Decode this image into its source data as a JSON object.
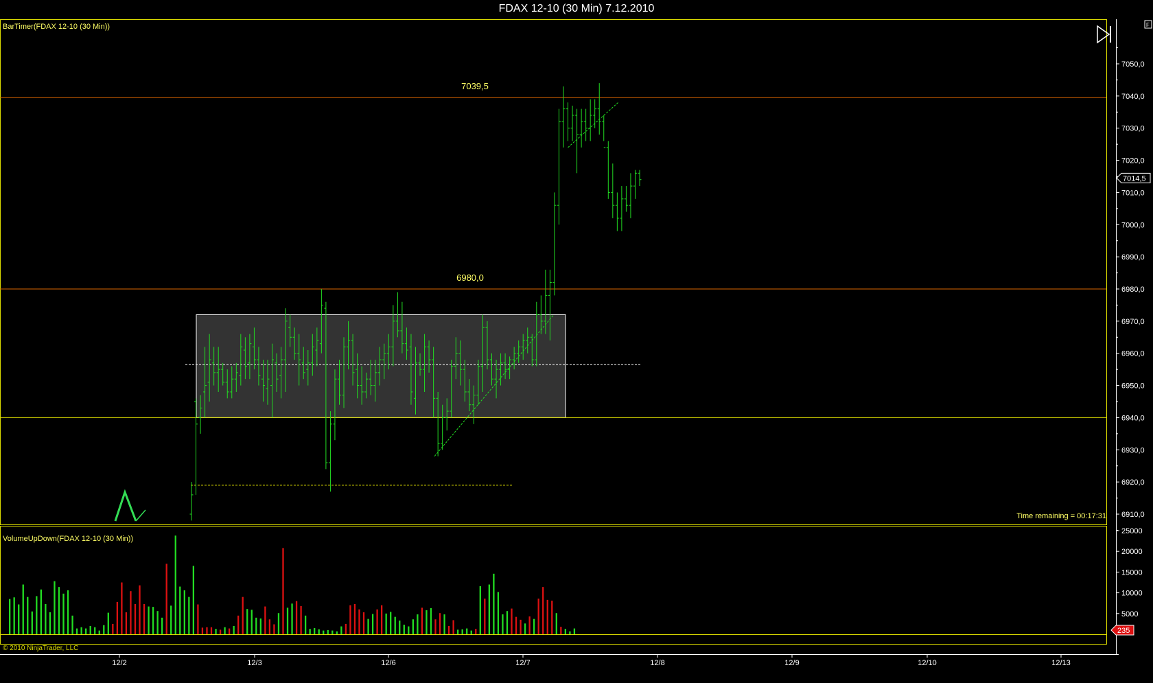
{
  "window": {
    "title": "FDAX 12-10 (30 Min)  7.12.2010"
  },
  "indicators": {
    "price_label": "BarTimer(FDAX 12-10 (30 Min))",
    "volume_label": "VolumeUpDown(FDAX 12-10 (30 Min))",
    "time_remaining": "Time remaining = 00:17:31",
    "copyright": "© 2010 NinjaTrader, LLC"
  },
  "colors": {
    "up": "#22dd22",
    "down": "#dd1111",
    "level_orange": "#dd6600",
    "level_yellow": "#dddd00",
    "panel_border": "#dddd00",
    "range_box": "#444444",
    "axis_text": "#ffffff"
  },
  "icons": {
    "play_end": "play-end-icon"
  },
  "chart_data": [
    {
      "type": "bar",
      "subtype": "ohlc",
      "title": "FDAX 12-10 (30 Min)  7.12.2010",
      "ylim": [
        6905,
        7062
      ],
      "y_ticks": [
        6910,
        6920,
        6930,
        6940,
        6950,
        6960,
        6970,
        6980,
        6990,
        7000,
        7010,
        7020,
        7030,
        7040,
        7050
      ],
      "y_tick_labels": [
        "6910,0",
        "6920,0",
        "6930,0",
        "6940,0",
        "6950,0",
        "6960,0",
        "6970,0",
        "6980,0",
        "6990,0",
        "7000,0",
        "7010,0",
        "7020,0",
        "7030,0",
        "7040,0",
        "7050,0"
      ],
      "x_tick_labels": [
        "12/2",
        "12/3",
        "12/6",
        "12/7",
        "12/8",
        "12/9",
        "12/10",
        "12/13"
      ],
      "levels": [
        {
          "value": 7039.5,
          "label": "7039,5",
          "color": "#dd6600"
        },
        {
          "value": 6980.0,
          "label": "6980,0",
          "color": "#dd6600"
        },
        {
          "value": 6940.0,
          "label": "",
          "color": "#dddd00"
        }
      ],
      "last_price": "7014,5",
      "range_box": {
        "top": 6972,
        "bottom": 6940
      },
      "midline": 6956.5,
      "support_dotted": 6919,
      "bars": [
        [
          6910,
          6908,
          6920,
          6916
        ],
        [
          6945,
          6916,
          6946,
          6938
        ],
        [
          6940,
          6935,
          6947,
          6943
        ],
        [
          6948,
          6940,
          6962,
          6950
        ],
        [
          6951,
          6945,
          6966,
          6958
        ],
        [
          6957,
          6950,
          6962,
          6954
        ],
        [
          6954,
          6948,
          6962,
          6955
        ],
        [
          6955,
          6950,
          6957,
          6951
        ],
        [
          6951,
          6946,
          6955,
          6948
        ],
        [
          6948,
          6946,
          6956,
          6952
        ],
        [
          6952,
          6948,
          6957,
          6954
        ],
        [
          6953,
          6950,
          6966,
          6962
        ],
        [
          6961,
          6952,
          6965,
          6956
        ],
        [
          6957,
          6952,
          6966,
          6963
        ],
        [
          6962,
          6955,
          6968,
          6958
        ],
        [
          6958,
          6950,
          6962,
          6953
        ],
        [
          6952,
          6945,
          6958,
          6950
        ],
        [
          6949,
          6944,
          6958,
          6952
        ],
        [
          6950,
          6940,
          6963,
          6958
        ],
        [
          6957,
          6948,
          6960,
          6952
        ],
        [
          6953,
          6946,
          6962,
          6958
        ],
        [
          6958,
          6948,
          6974,
          6970
        ],
        [
          6968,
          6962,
          6972,
          6965
        ],
        [
          6965,
          6958,
          6968,
          6960
        ],
        [
          6960,
          6950,
          6966,
          6958
        ],
        [
          6957,
          6952,
          6962,
          6954
        ],
        [
          6955,
          6950,
          6961,
          6957
        ],
        [
          6957,
          6953,
          6966,
          6962
        ],
        [
          6961,
          6956,
          6968,
          6964
        ],
        [
          6963,
          6960,
          6980,
          6975
        ],
        [
          6974,
          6924,
          6976,
          6926
        ],
        [
          6926,
          6917,
          6942,
          6938
        ],
        [
          6938,
          6933,
          6955,
          6952
        ],
        [
          6952,
          6944,
          6958,
          6947
        ],
        [
          6947,
          6943,
          6965,
          6962
        ],
        [
          6962,
          6955,
          6970,
          6964
        ],
        [
          6964,
          6950,
          6966,
          6954
        ],
        [
          6955,
          6946,
          6960,
          6950
        ],
        [
          6950,
          6944,
          6956,
          6948
        ],
        [
          6948,
          6946,
          6954,
          6952
        ],
        [
          6952,
          6947,
          6958,
          6950
        ],
        [
          6950,
          6945,
          6958,
          6954
        ],
        [
          6954,
          6950,
          6962,
          6958
        ],
        [
          6958,
          6952,
          6963,
          6960
        ],
        [
          6960,
          6955,
          6966,
          6962
        ],
        [
          6962,
          6956,
          6975,
          6970
        ],
        [
          6970,
          6965,
          6979,
          6967
        ],
        [
          6967,
          6960,
          6976,
          6963
        ],
        [
          6963,
          6958,
          6968,
          6961
        ],
        [
          6962,
          6944,
          6966,
          6948
        ],
        [
          6946,
          6941,
          6962,
          6957
        ],
        [
          6957,
          6953,
          6960,
          6955
        ],
        [
          6955,
          6948,
          6966,
          6962
        ],
        [
          6962,
          6954,
          6964,
          6958
        ],
        [
          6958,
          6940,
          6962,
          6946
        ],
        [
          6946,
          6928,
          6948,
          6932
        ],
        [
          6932,
          6930,
          6944,
          6940
        ],
        [
          6940,
          6936,
          6946,
          6942
        ],
        [
          6942,
          6940,
          6958,
          6956
        ],
        [
          6956,
          6952,
          6965,
          6960
        ],
        [
          6960,
          6950,
          6964,
          6955
        ],
        [
          6955,
          6945,
          6958,
          6948
        ],
        [
          6948,
          6942,
          6952,
          6944
        ],
        [
          6944,
          6938,
          6950,
          6947
        ],
        [
          6947,
          6944,
          6958,
          6956
        ],
        [
          6956,
          6948,
          6972,
          6968
        ],
        [
          6968,
          6955,
          6970,
          6958
        ],
        [
          6958,
          6950,
          6960,
          6952
        ],
        [
          6952,
          6946,
          6958,
          6955
        ],
        [
          6955,
          6950,
          6960,
          6957
        ],
        [
          6957,
          6952,
          6960,
          6955
        ],
        [
          6955,
          6952,
          6959,
          6958
        ],
        [
          6958,
          6955,
          6962,
          6960
        ],
        [
          6960,
          6957,
          6964,
          6962
        ],
        [
          6962,
          6958,
          6966,
          6964
        ],
        [
          6964,
          6960,
          6968,
          6965
        ],
        [
          6965,
          6956,
          6966,
          6958
        ],
        [
          6958,
          6956,
          6976,
          6972
        ],
        [
          6972,
          6966,
          6978,
          6970
        ],
        [
          6970,
          6966,
          6986,
          6978
        ],
        [
          6978,
          6964,
          6986,
          6982
        ],
        [
          6982,
          6978,
          7010,
          7006
        ],
        [
          7006,
          7000,
          7036,
          7032
        ],
        [
          7032,
          7024,
          7043,
          7036
        ],
        [
          7036,
          7026,
          7038,
          7030
        ],
        [
          7030,
          7026,
          7037,
          7034
        ],
        [
          7034,
          7016,
          7036,
          7028
        ],
        [
          7028,
          7024,
          7036,
          7032
        ],
        [
          7032,
          7026,
          7036,
          7030
        ],
        [
          7030,
          7026,
          7039,
          7034
        ],
        [
          7034,
          7030,
          7039,
          7036
        ],
        [
          7036,
          7028,
          7044,
          7032
        ],
        [
          7032,
          7026,
          7034,
          7024
        ],
        [
          7024,
          7008,
          7026,
          7010
        ],
        [
          7010,
          7002,
          7019,
          7006
        ],
        [
          7006,
          6998,
          7010,
          7002
        ],
        [
          7002,
          6998,
          7012,
          7008
        ],
        [
          7008,
          7004,
          7012,
          7006
        ],
        [
          7006,
          7002,
          7016,
          7012
        ],
        [
          7012,
          7008,
          7017,
          7016
        ],
        [
          7016,
          7012,
          7017,
          7014
        ]
      ]
    },
    {
      "type": "bar",
      "title": "VolumeUpDown(FDAX 12-10 (30 Min))",
      "ylim": [
        0,
        26000
      ],
      "y_ticks": [
        5000,
        10000,
        15000,
        20000,
        25000
      ],
      "y_tick_labels": [
        "5000",
        "10000",
        "15000",
        "20000",
        "25000"
      ],
      "last_value": "235",
      "bars": [
        [
          8500,
          "up"
        ],
        [
          8900,
          "up"
        ],
        [
          7200,
          "up"
        ],
        [
          12000,
          "up"
        ],
        [
          9000,
          "up"
        ],
        [
          5500,
          "up"
        ],
        [
          9200,
          "up"
        ],
        [
          10800,
          "up"
        ],
        [
          7300,
          "up"
        ],
        [
          5300,
          "up"
        ],
        [
          12800,
          "up"
        ],
        [
          11400,
          "up"
        ],
        [
          9800,
          "up"
        ],
        [
          10600,
          "up"
        ],
        [
          4500,
          "up"
        ],
        [
          1400,
          "up"
        ],
        [
          1700,
          "up"
        ],
        [
          1400,
          "up"
        ],
        [
          2000,
          "up"
        ],
        [
          1700,
          "up"
        ],
        [
          900,
          "up"
        ],
        [
          2200,
          "up"
        ],
        [
          5200,
          "up"
        ],
        [
          2500,
          "down"
        ],
        [
          7800,
          "down"
        ],
        [
          12500,
          "down"
        ],
        [
          5300,
          "down"
        ],
        [
          10400,
          "down"
        ],
        [
          7300,
          "down"
        ],
        [
          11800,
          "down"
        ],
        [
          7300,
          "down"
        ],
        [
          6700,
          "up"
        ],
        [
          6600,
          "up"
        ],
        [
          5600,
          "up"
        ],
        [
          4000,
          "up"
        ],
        [
          17000,
          "down"
        ],
        [
          6900,
          "up"
        ],
        [
          23800,
          "up"
        ],
        [
          11500,
          "up"
        ],
        [
          10600,
          "up"
        ],
        [
          9000,
          "up"
        ],
        [
          16500,
          "up"
        ],
        [
          7200,
          "down"
        ],
        [
          1600,
          "down"
        ],
        [
          1700,
          "down"
        ],
        [
          1700,
          "down"
        ],
        [
          1300,
          "up"
        ],
        [
          1100,
          "down"
        ],
        [
          1700,
          "up"
        ],
        [
          1400,
          "down"
        ],
        [
          2000,
          "up"
        ],
        [
          4500,
          "down"
        ],
        [
          9000,
          "down"
        ],
        [
          6100,
          "up"
        ],
        [
          5900,
          "up"
        ],
        [
          4000,
          "up"
        ],
        [
          3800,
          "up"
        ],
        [
          6700,
          "down"
        ],
        [
          3600,
          "down"
        ],
        [
          2400,
          "down"
        ],
        [
          5100,
          "up"
        ],
        [
          20800,
          "down"
        ],
        [
          6400,
          "up"
        ],
        [
          7400,
          "up"
        ],
        [
          8000,
          "down"
        ],
        [
          6800,
          "down"
        ],
        [
          4500,
          "up"
        ],
        [
          1300,
          "up"
        ],
        [
          1500,
          "up"
        ],
        [
          1200,
          "up"
        ],
        [
          900,
          "up"
        ],
        [
          1000,
          "up"
        ],
        [
          900,
          "up"
        ],
        [
          700,
          "up"
        ],
        [
          1900,
          "up"
        ],
        [
          2500,
          "down"
        ],
        [
          7000,
          "down"
        ],
        [
          7300,
          "down"
        ],
        [
          6000,
          "down"
        ],
        [
          5300,
          "down"
        ],
        [
          3700,
          "up"
        ],
        [
          4900,
          "up"
        ],
        [
          6000,
          "down"
        ],
        [
          7000,
          "down"
        ],
        [
          5000,
          "up"
        ],
        [
          5400,
          "up"
        ],
        [
          4200,
          "up"
        ],
        [
          3300,
          "up"
        ],
        [
          2300,
          "up"
        ],
        [
          1900,
          "up"
        ],
        [
          3600,
          "up"
        ],
        [
          4800,
          "up"
        ],
        [
          6400,
          "down"
        ],
        [
          5800,
          "up"
        ],
        [
          6300,
          "up"
        ],
        [
          3600,
          "down"
        ],
        [
          5100,
          "down"
        ],
        [
          4800,
          "up"
        ],
        [
          2000,
          "down"
        ],
        [
          3400,
          "down"
        ],
        [
          1100,
          "up"
        ],
        [
          1200,
          "up"
        ],
        [
          1400,
          "up"
        ],
        [
          900,
          "up"
        ],
        [
          1300,
          "down"
        ],
        [
          11600,
          "up"
        ],
        [
          8600,
          "down"
        ],
        [
          12000,
          "up"
        ],
        [
          14600,
          "up"
        ],
        [
          10200,
          "up"
        ],
        [
          4800,
          "up"
        ],
        [
          5600,
          "up"
        ],
        [
          6200,
          "down"
        ],
        [
          4200,
          "down"
        ],
        [
          3500,
          "down"
        ],
        [
          2600,
          "up"
        ],
        [
          4300,
          "down"
        ],
        [
          3700,
          "up"
        ],
        [
          8600,
          "down"
        ],
        [
          11400,
          "down"
        ],
        [
          8300,
          "down"
        ],
        [
          8100,
          "down"
        ],
        [
          5100,
          "up"
        ],
        [
          1800,
          "down"
        ],
        [
          1300,
          "up"
        ],
        [
          700,
          "up"
        ],
        [
          1400,
          "up"
        ]
      ]
    }
  ]
}
